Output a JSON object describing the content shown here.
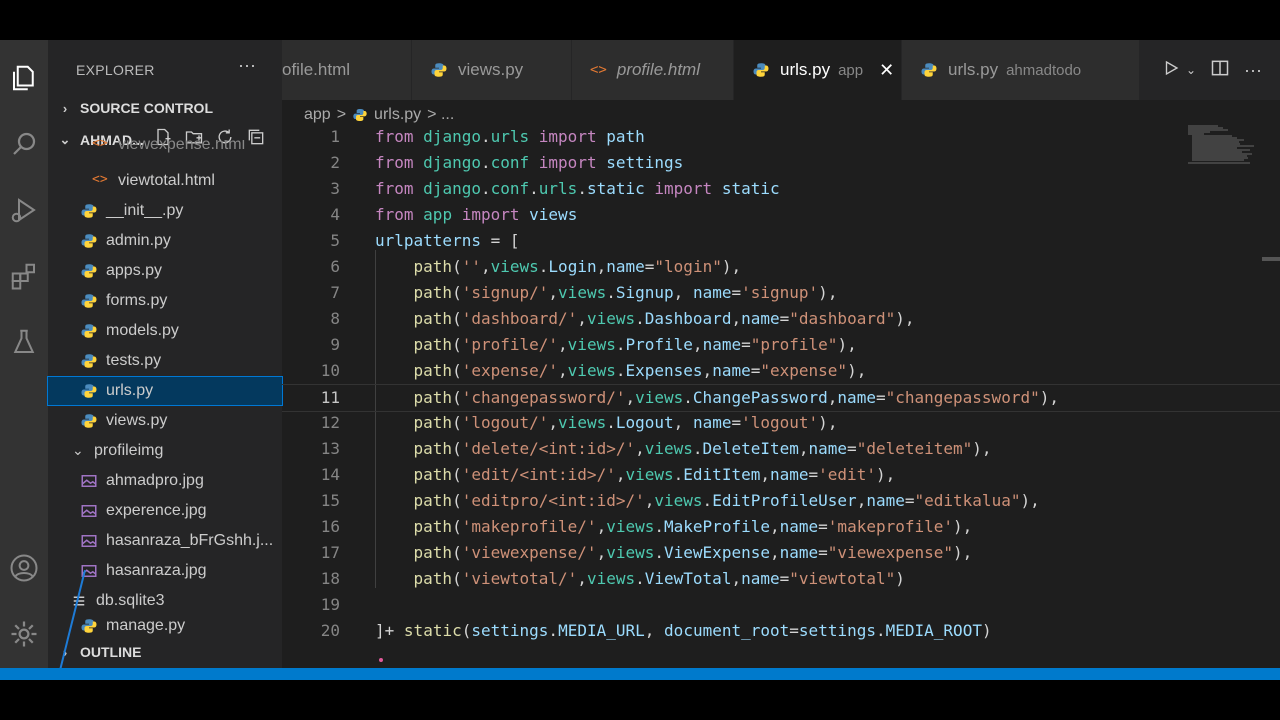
{
  "explorer": {
    "title": "EXPLORER",
    "more": "···",
    "source_control": "SOURCE CONTROL",
    "project": "AHMAD...",
    "outline": "OUTLINE",
    "files": [
      {
        "name": "viewexpense.html",
        "type": "html"
      },
      {
        "name": "viewtotal.html",
        "type": "html"
      },
      {
        "name": "__init__.py",
        "type": "py"
      },
      {
        "name": "admin.py",
        "type": "py"
      },
      {
        "name": "apps.py",
        "type": "py"
      },
      {
        "name": "forms.py",
        "type": "py"
      },
      {
        "name": "models.py",
        "type": "py"
      },
      {
        "name": "tests.py",
        "type": "py"
      },
      {
        "name": "urls.py",
        "type": "py"
      },
      {
        "name": "views.py",
        "type": "py"
      },
      {
        "name": "profileimg",
        "type": "folder"
      },
      {
        "name": "ahmadpro.jpg",
        "type": "img"
      },
      {
        "name": "experence.jpg",
        "type": "img"
      },
      {
        "name": "hasanraza_bFrGshh.j...",
        "type": "img"
      },
      {
        "name": "hasanraza.jpg",
        "type": "img"
      },
      {
        "name": "db.sqlite3",
        "type": "db"
      },
      {
        "name": "manage.py",
        "type": "py"
      }
    ],
    "selected_file": "urls.py"
  },
  "tabs": [
    {
      "label": "ofile.html",
      "desc": ""
    },
    {
      "label": "views.py",
      "desc": ""
    },
    {
      "label": "profile.html",
      "desc": ""
    },
    {
      "label": "urls.py",
      "desc": "app",
      "close": "✕"
    },
    {
      "label": "urls.py",
      "desc": "ahmadtodo"
    }
  ],
  "breadcrumb": {
    "folder": "app",
    "sep": ">",
    "file": "urls.py",
    "sep2": "> ..."
  },
  "code": {
    "current_line": 11,
    "lines": [
      {
        "n": "1",
        "t": "from django.urls import path"
      },
      {
        "n": "2",
        "t": "from django.conf import settings"
      },
      {
        "n": "3",
        "t": "from django.conf.urls.static import static"
      },
      {
        "n": "4",
        "t": "from app import views"
      },
      {
        "n": "5",
        "t": "urlpatterns = ["
      },
      {
        "n": "6",
        "t": "    path('',views.Login,name=\"login\"),"
      },
      {
        "n": "7",
        "t": "    path('signup/',views.Signup, name='signup'),"
      },
      {
        "n": "8",
        "t": "    path('dashboard/',views.Dashboard,name=\"dashboard\"),"
      },
      {
        "n": "9",
        "t": "    path('profile/',views.Profile,name=\"profile\"),"
      },
      {
        "n": "10",
        "t": "    path('expense/',views.Expenses,name=\"expense\"),"
      },
      {
        "n": "11",
        "t": "    path('changepassword/',views.ChangePassword,name=\"changepassword\"),"
      },
      {
        "n": "12",
        "t": "    path('logout/',views.Logout, name='logout'),"
      },
      {
        "n": "13",
        "t": "    path('delete/<int:id>/',views.DeleteItem,name=\"deleteitem\"),"
      },
      {
        "n": "14",
        "t": "    path('edit/<int:id>/',views.EditItem,name='edit'),"
      },
      {
        "n": "15",
        "t": "    path('editpro/<int:id>/',views.EditProfileUser,name=\"editkalua\"),"
      },
      {
        "n": "16",
        "t": "    path('makeprofile/',views.MakeProfile,name='makeprofile'),"
      },
      {
        "n": "17",
        "t": "    path('viewexpense/',views.ViewExpense,name=\"viewexpense\"),"
      },
      {
        "n": "18",
        "t": "    path('viewtotal/',views.ViewTotal,name=\"viewtotal\")"
      },
      {
        "n": "19",
        "t": ""
      },
      {
        "n": "20",
        "t": "]+ static(settings.MEDIA_URL, document_root=settings.MEDIA_ROOT)"
      }
    ]
  },
  "colors": {
    "accent": "#007acc",
    "keyword": "#c586c0",
    "module": "#4ec9b0",
    "variable": "#9cdcfe",
    "function": "#dcdcaa",
    "string": "#ce9178"
  }
}
